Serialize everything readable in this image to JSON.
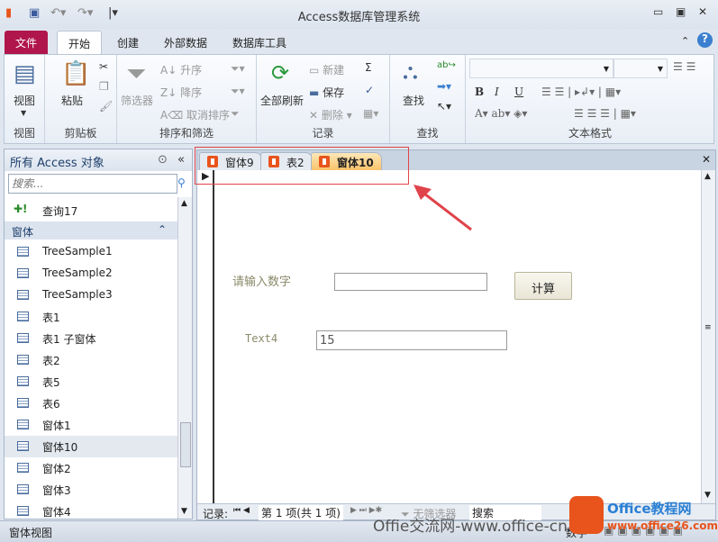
{
  "window": {
    "title": "Access数据库管理系统"
  },
  "ribbon_tabs": [
    "文件",
    "开始",
    "创建",
    "外部数据",
    "数据库工具"
  ],
  "groups": {
    "view": {
      "label": "视图",
      "button": "视图"
    },
    "clipboard": {
      "label": "剪贴板",
      "paste": "粘贴"
    },
    "sort": {
      "label": "排序和筛选",
      "filter": "筛选器",
      "asc": "升序",
      "desc": "降序",
      "clear": "取消排序"
    },
    "records": {
      "label": "记录",
      "refresh": "全部刷新",
      "new": "新建",
      "save": "保存",
      "delete": "删除"
    },
    "find": {
      "label": "查找",
      "find": "查找"
    },
    "text": {
      "label": "文本格式"
    }
  },
  "nav": {
    "title": "所有 Access 对象",
    "search_placeholder": "搜索...",
    "query": "查询17",
    "group": "窗体",
    "items": [
      "TreeSample1",
      "TreeSample2",
      "TreeSample3",
      "表1",
      "表1 子窗体",
      "表2",
      "表5",
      "表6",
      "窗体1",
      "窗体10",
      "窗体2",
      "窗体3",
      "窗体4"
    ],
    "selected": "窗体10"
  },
  "doc_tabs": [
    "窗体9",
    "表2",
    "窗体10"
  ],
  "active_tab": "窗体10",
  "form": {
    "prompt_label": "请输入数字",
    "prompt_value": "",
    "calc_button": "计算",
    "text4_label": "Text4",
    "text4_value": "15"
  },
  "record_nav": {
    "label": "记录:",
    "position": "第 1 项(共 1 项)",
    "filter": "无筛选器",
    "search": "搜索"
  },
  "status": {
    "left": "窗体视图",
    "right": "数字"
  },
  "watermark": {
    "text": "Offie交流网-www.office-cn",
    "logo": "Office教程网 www.office26.com"
  }
}
